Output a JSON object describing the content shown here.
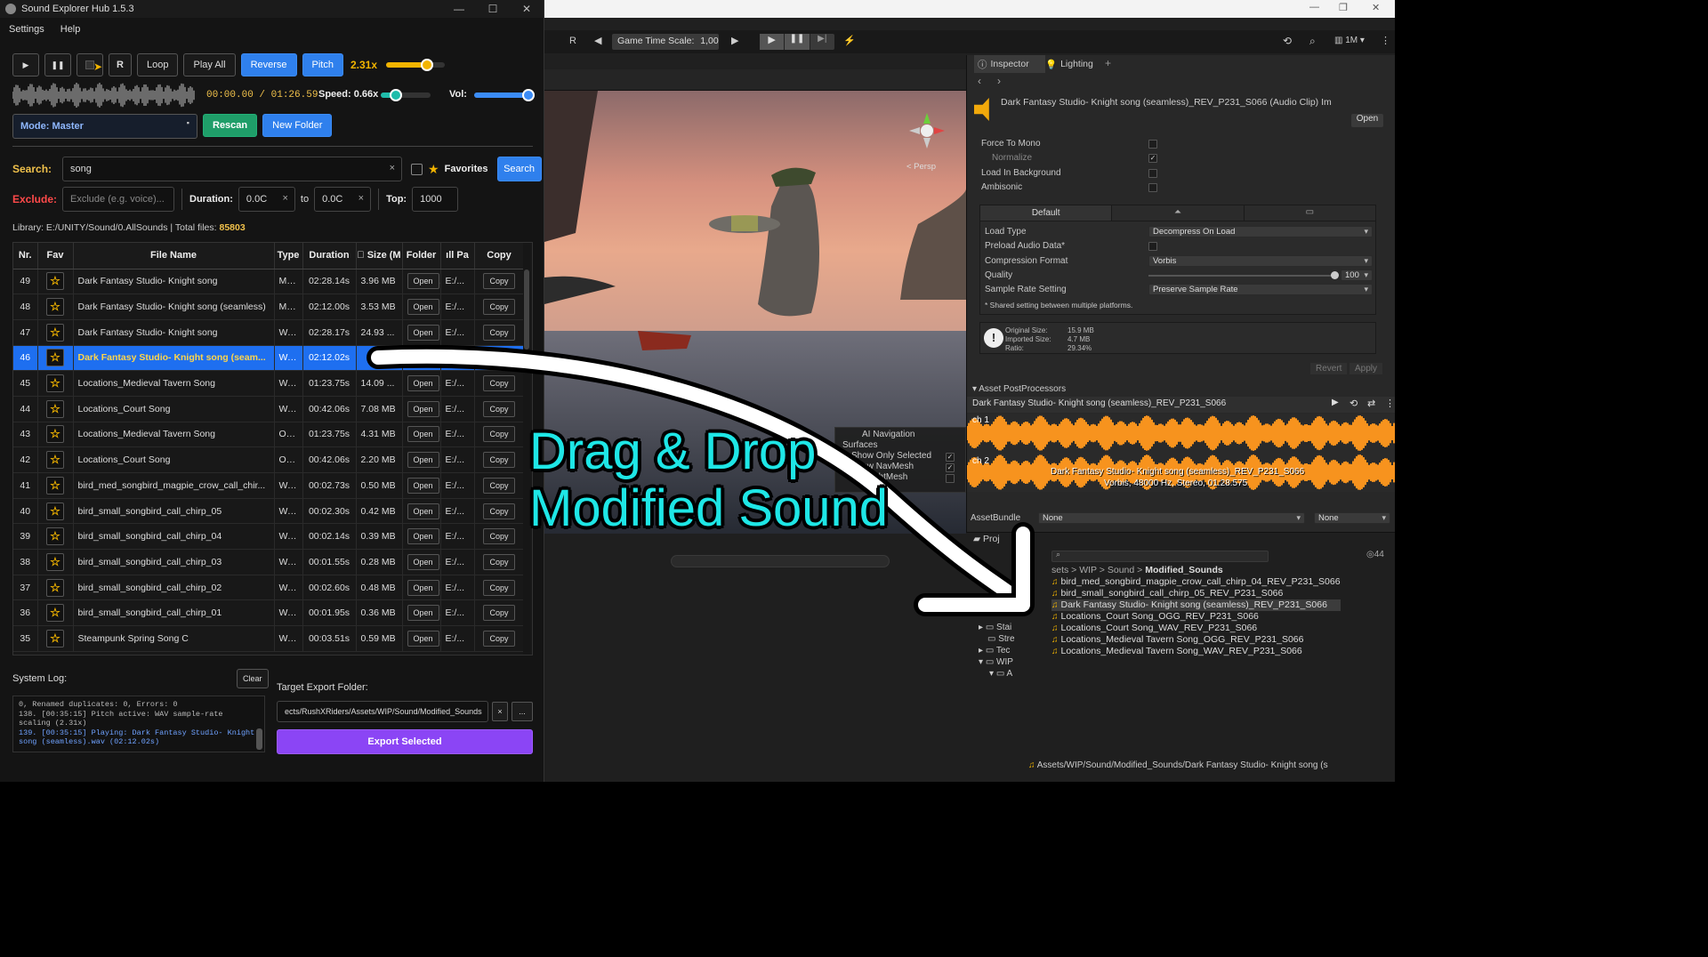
{
  "app": {
    "title": "Sound Explorer Hub 1.5.3",
    "menu": [
      "Settings",
      "Help"
    ],
    "transport": {
      "r_label": "R",
      "loop": "Loop",
      "play_all": "Play All",
      "reverse": "Reverse",
      "pitch": "Pitch",
      "pitch_rate": "2.31x",
      "pitch_level": 0.7,
      "time": "00:00.00 / 01:26.59",
      "speed_label": "Speed: 0.66x",
      "speed_level": 0.3,
      "vol_label": "Vol:",
      "vol_level": 0.95
    },
    "mode": "Mode: Master",
    "rescan": "Rescan",
    "new_folder": "New Folder",
    "search": {
      "label": "Search:",
      "value": "song",
      "favorites": "Favorites",
      "button": "Search"
    },
    "exclude": {
      "label": "Exclude:",
      "placeholder": "Exclude (e.g. voice)...",
      "duration_label": "Duration:",
      "dur_from": "0.0C",
      "to": "to",
      "dur_to": "0.0C",
      "top_label": "Top:",
      "top": "1000"
    },
    "library_prefix": "Library: E:/UNITY/Sound/0.AllSounds | Total files: ",
    "total_files": "85803",
    "table": {
      "headers": [
        "Nr.",
        "Fav",
        "File Name",
        "Type",
        "Duration",
        "\u0000 Size (M",
        "Folder",
        "ıll Pa",
        "Copy"
      ],
      "open_label": "Open",
      "copy_label": "Copy",
      "rows": [
        {
          "nr": "49",
          "name": "Dark Fantasy Studio- Knight song",
          "type": "MP3",
          "duration": "02:28.14s",
          "size": "3.96 MB",
          "path": "E:/...",
          "selected": false
        },
        {
          "nr": "48",
          "name": "Dark Fantasy Studio- Knight song (seamless)",
          "type": "MP3",
          "duration": "02:12.00s",
          "size": "3.53 MB",
          "path": "E:/...",
          "selected": false
        },
        {
          "nr": "47",
          "name": "Dark Fantasy Studio- Knight song",
          "type": "WAV",
          "duration": "02:28.17s",
          "size": "24.93 ...",
          "path": "E:/...",
          "selected": false
        },
        {
          "nr": "46",
          "name": "Dark Fantasy Studio- Knight song (seam...",
          "type": "WAV",
          "duration": "02:12.02s",
          "size": "",
          "path": "",
          "selected": true
        },
        {
          "nr": "45",
          "name": "Locations_Medieval Tavern Song",
          "type": "WAV",
          "duration": "01:23.75s",
          "size": "14.09 ...",
          "path": "E:/...",
          "selected": false
        },
        {
          "nr": "44",
          "name": "Locations_Court Song",
          "type": "WAV",
          "duration": "00:42.06s",
          "size": "7.08 MB",
          "path": "E:/...",
          "selected": false
        },
        {
          "nr": "43",
          "name": "Locations_Medieval Tavern Song",
          "type": "OGG",
          "duration": "01:23.75s",
          "size": "4.31 MB",
          "path": "E:/...",
          "selected": false
        },
        {
          "nr": "42",
          "name": "Locations_Court Song",
          "type": "OGG",
          "duration": "00:42.06s",
          "size": "2.20 MB",
          "path": "E:/...",
          "selected": false
        },
        {
          "nr": "41",
          "name": "bird_med_songbird_magpie_crow_call_chir...",
          "type": "WAV",
          "duration": "00:02.73s",
          "size": "0.50 MB",
          "path": "E:/...",
          "selected": false
        },
        {
          "nr": "40",
          "name": "bird_small_songbird_call_chirp_05",
          "type": "WAV",
          "duration": "00:02.30s",
          "size": "0.42 MB",
          "path": "E:/...",
          "selected": false
        },
        {
          "nr": "39",
          "name": "bird_small_songbird_call_chirp_04",
          "type": "WAV",
          "duration": "00:02.14s",
          "size": "0.39 MB",
          "path": "E:/...",
          "selected": false
        },
        {
          "nr": "38",
          "name": "bird_small_songbird_call_chirp_03",
          "type": "WAV",
          "duration": "00:01.55s",
          "size": "0.28 MB",
          "path": "E:/...",
          "selected": false
        },
        {
          "nr": "37",
          "name": "bird_small_songbird_call_chirp_02",
          "type": "WAV",
          "duration": "00:02.60s",
          "size": "0.48 MB",
          "path": "E:/...",
          "selected": false
        },
        {
          "nr": "36",
          "name": "bird_small_songbird_call_chirp_01",
          "type": "WAV",
          "duration": "00:01.95s",
          "size": "0.36 MB",
          "path": "E:/...",
          "selected": false
        },
        {
          "nr": "35",
          "name": "Steampunk Spring Song C",
          "type": "WAV",
          "duration": "00:03.51s",
          "size": "0.59 MB",
          "path": "E:/...",
          "selected": false
        }
      ]
    },
    "system_log_label": "System Log:",
    "clear": "Clear",
    "log_lines": [
      "0, Renamed duplicates: 0, Errors: 0",
      "138. [00:35:15] Pitch active: WAV sample-rate scaling (2.31x)",
      "139. [00:35:15] Playing: Dark Fantasy Studio- Knight song (seamless).wav (02:12.02s)"
    ],
    "export_label": "Target Export Folder:",
    "export_path": "ects/RushXRiders/Assets/WIP/Sound/Modified_Sounds",
    "export_x": "×",
    "export_dots": "...",
    "export_button": "Export Selected"
  },
  "unity": {
    "toolbar": {
      "r": "R",
      "game_time_label": "Game Time Scale:",
      "game_time_value": "1,00",
      "layers": "1M"
    },
    "scene": {
      "persp": "< Persp",
      "ai_nav": "AI Navigation",
      "surfaces": "Surfaces",
      "show_only_selected": "Show Only Selected",
      "show_navmesh": "Show NavMesh",
      "show_heightmesh": "w HeightMesh"
    },
    "inspector": {
      "tab_inspector": "Inspector",
      "tab_lighting": "Lighting",
      "asset_title": "Dark Fantasy Studio- Knight song (seamless)_REV_P231_S066 (Audio Clip) Im",
      "open": "Open",
      "force_to_mono": "Force To Mono",
      "normalize": "Normalize",
      "load_in_background": "Load In Background",
      "ambisonic": "Ambisonic",
      "default_tab": "Default",
      "load_type_label": "Load Type",
      "load_type": "Decompress On Load",
      "preload": "Preload Audio Data*",
      "compression_label": "Compression Format",
      "compression": "Vorbis",
      "quality_label": "Quality",
      "quality": "100",
      "sample_rate_label": "Sample Rate Setting",
      "sample_rate": "Preserve Sample Rate",
      "shared_note": "* Shared setting between multiple platforms.",
      "original_size": "Original Size:",
      "original_size_val": "15.9 MB",
      "imported_size": "Imported Size:",
      "imported_size_val": "4.7 MB",
      "ratio": "Ratio:",
      "ratio_val": "29.34%",
      "revert": "Revert",
      "apply": "Apply",
      "postprocessors": "Asset PostProcessors",
      "preview_title": "Dark Fantasy Studio- Knight song (seamless)_REV_P231_S066",
      "ch1": "ch 1",
      "ch2": "ch 2",
      "preview_name": "Dark Fantasy Studio- Knight song (seamless)_REV_P231_S066",
      "preview_info": "Vorbis, 48000 Hz, Stereo, 01:28.575",
      "assetbundle": "AssetBundle",
      "ab_none1": "None",
      "ab_none2": "None"
    },
    "project": {
      "tab": "Proj",
      "count": "44",
      "breadcrumb": [
        "sets",
        "WIP",
        "Sound",
        "Modified_Sounds"
      ],
      "files": [
        "bird_med_songbird_magpie_crow_call_chirp_04_REV_P231_S066",
        "bird_small_songbird_call_chirp_05_REV_P231_S066",
        "Dark Fantasy Studio- Knight song (seamless)_REV_P231_S066",
        "Locations_Court Song_OGG_REV_P231_S066",
        "Locations_Court Song_WAV_REV_P231_S066",
        "Locations_Medieval Tavern Song_OGG_REV_P231_S066",
        "Locations_Medieval Tavern Song_WAV_REV_P231_S066"
      ],
      "tree": [
        "Stai",
        "Stre",
        "Tec",
        "WIP",
        "A"
      ],
      "status_path": "Assets/WIP/Sound/Modified_Sounds/Dark Fantasy Studio- Knight song (s"
    }
  },
  "overlay": {
    "line1": "Drag & Drop",
    "line2": "Modified Sound",
    "color": "#1ee6e6"
  },
  "colors": {
    "accent_blue": "#2f80ed",
    "accent_green": "#1f9e69",
    "export_purple": "#8b45f5",
    "waveform_orange": "#f7931e",
    "label_yellow": "#f0c14b"
  }
}
